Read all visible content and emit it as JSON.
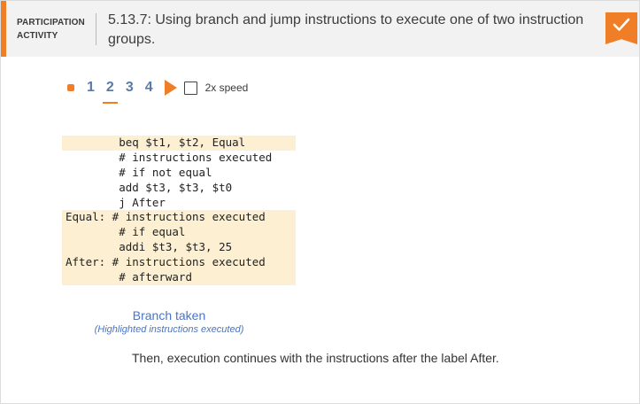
{
  "header": {
    "participation_line1": "PARTICIPATION",
    "participation_line2": "ACTIVITY",
    "title": "5.13.7: Using branch and jump instructions to execute one of two instruction groups.",
    "check_icon": "check-icon",
    "accent_color": "#f07e26"
  },
  "controls": {
    "steps": [
      "1",
      "2",
      "3",
      "4"
    ],
    "active_step": "2",
    "speed_label": "2x speed",
    "speed_checked": false
  },
  "code": {
    "lines": [
      {
        "text": "        beq $t1, $t2, Equal",
        "highlighted": true
      },
      {
        "text": "        # instructions executed",
        "highlighted": false
      },
      {
        "text": "        # if not equal",
        "highlighted": false
      },
      {
        "text": "        add $t3, $t3, $t0",
        "highlighted": false
      },
      {
        "text": "        j After",
        "highlighted": false
      },
      {
        "text": "Equal: # instructions executed",
        "highlighted": true
      },
      {
        "text": "        # if equal",
        "highlighted": true
      },
      {
        "text": "        addi $t3, $t3, 25",
        "highlighted": true
      },
      {
        "text": "After: # instructions executed",
        "highlighted": true
      },
      {
        "text": "        # afterward",
        "highlighted": true
      }
    ],
    "highlight_color": "#fdf0d2"
  },
  "caption": {
    "title": "Branch taken",
    "subtitle": "(Highlighted instructions executed)"
  },
  "description": "Then, execution continues with the instructions after the label After."
}
